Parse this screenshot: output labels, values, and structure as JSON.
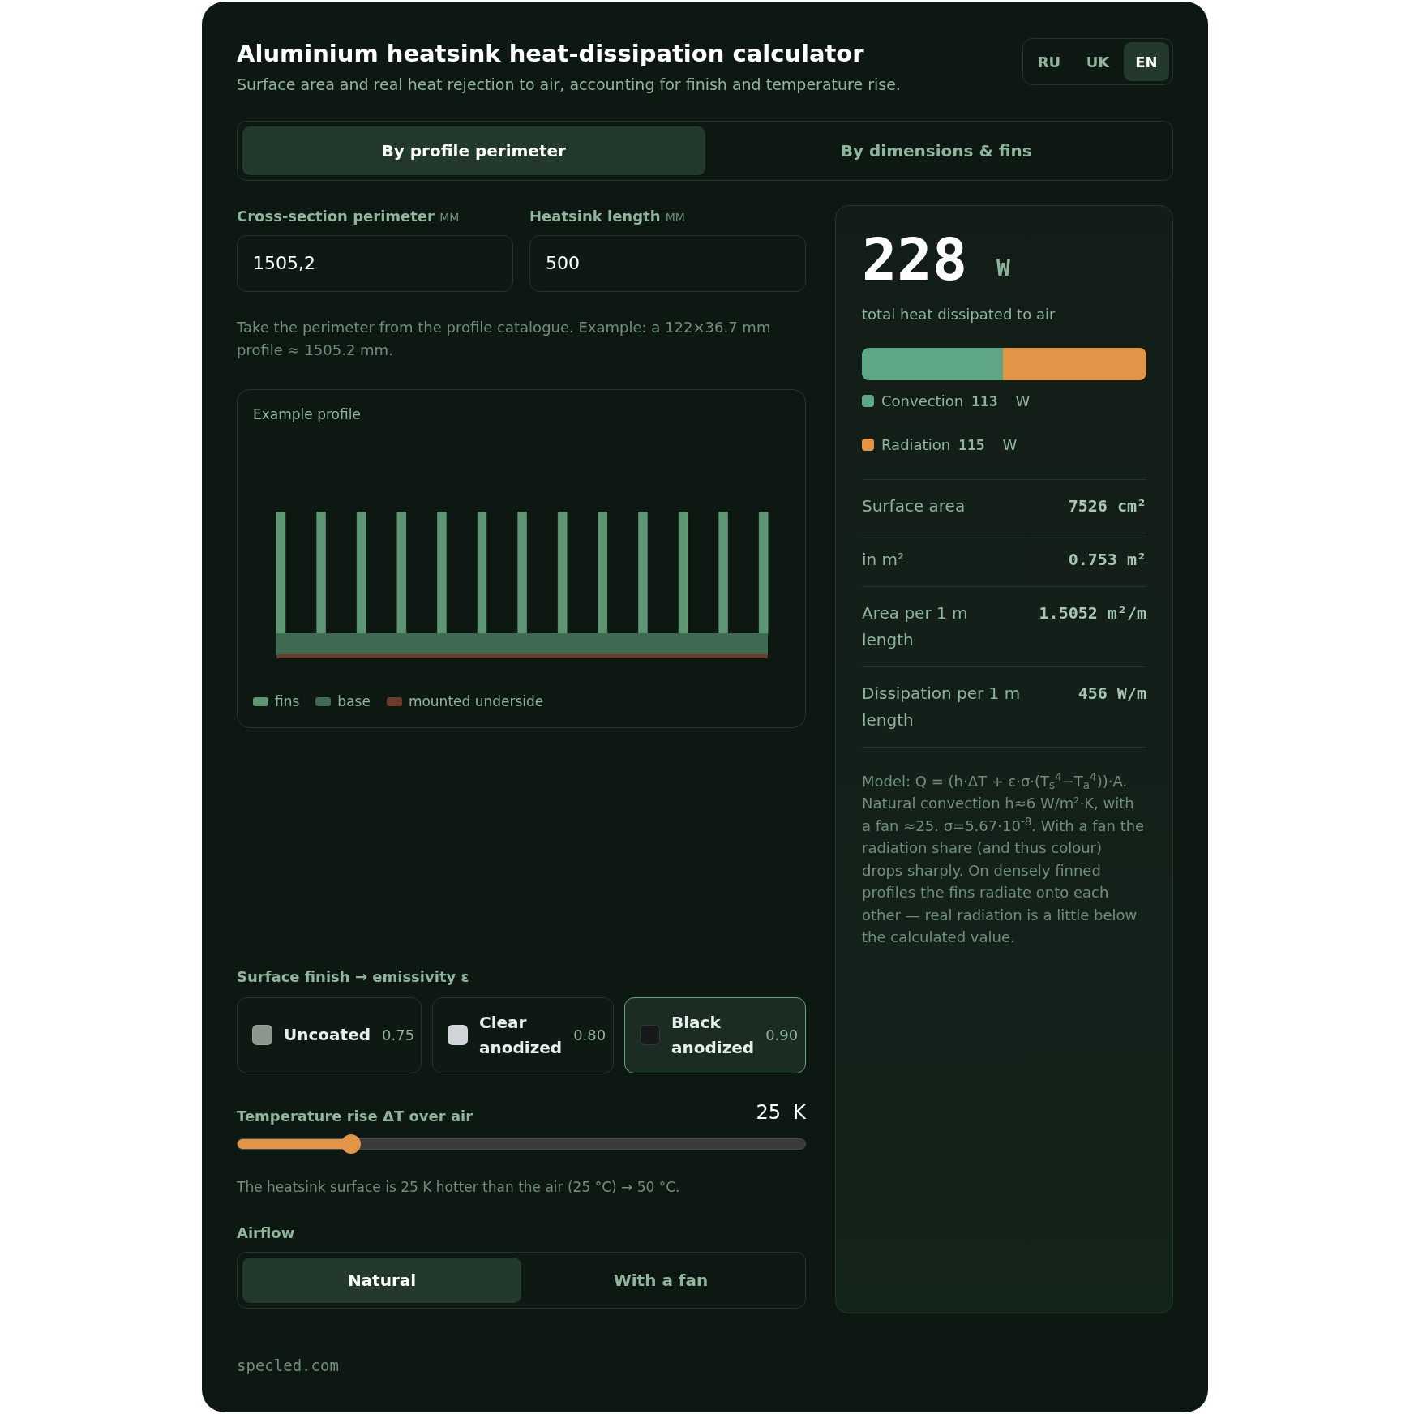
{
  "header": {
    "title": "Aluminium heatsink heat-dissipation calculator",
    "subtitle": "Surface area and real heat rejection to air, accounting for finish and temperature rise."
  },
  "languages": [
    {
      "label": "RU",
      "selected": false
    },
    {
      "label": "UK",
      "selected": false
    },
    {
      "label": "EN",
      "selected": true
    }
  ],
  "mode_tabs": [
    {
      "label": "By profile perimeter",
      "selected": true
    },
    {
      "label": "By dimensions & fins",
      "selected": false
    }
  ],
  "inputs": [
    {
      "label": "Cross-section perimeter",
      "unit": "MM",
      "value": "1505,2"
    },
    {
      "label": "Heatsink length",
      "unit": "MM",
      "value": "500"
    }
  ],
  "input_hint": "Take the perimeter from the profile catalogue. Example: a 122×36.7 mm profile ≈ 1505.2 mm.",
  "profile": {
    "title": "Example profile",
    "legend": [
      {
        "label": "fins",
        "color": "#5e9673"
      },
      {
        "label": "base",
        "color": "#3f6b52"
      },
      {
        "label": "mounted underside",
        "color": "#6b3b2c"
      }
    ]
  },
  "finish": {
    "label": "Surface finish → emissivity ε",
    "options": [
      {
        "label": "Uncoated",
        "value": "0.75",
        "color": "#8b968e",
        "selected": false
      },
      {
        "label": "Clear anodized",
        "value": "0.80",
        "color": "#d0d3d8",
        "selected": false
      },
      {
        "label": "Black anodized",
        "value": "0.90",
        "color": "#17191a",
        "selected": true
      }
    ]
  },
  "temperature": {
    "label": "Temperature rise ΔT over air",
    "value": "25",
    "unit": "K",
    "level": 0.2,
    "note": "The heatsink surface is 25 K hotter than the air (25 °C) → 50 °C."
  },
  "airflow": {
    "label": "Airflow",
    "options": [
      {
        "label": "Natural",
        "selected": true
      },
      {
        "label": "With a fan",
        "selected": false
      }
    ]
  },
  "footer": "specled.com",
  "result": {
    "value": "228",
    "unit": "W",
    "caption": "total heat dissipated to air",
    "parts": [
      {
        "label": "Convection",
        "value": "113",
        "unit": "W",
        "color": "#5fa784",
        "level": 0.495
      },
      {
        "label": "Radiation",
        "value": "115",
        "unit": "W",
        "color": "#e39547",
        "level": 0.505
      }
    ],
    "stats": [
      {
        "label": "Surface area",
        "value": "7526 cm²"
      },
      {
        "label": "in m²",
        "value": "0.753 m²"
      },
      {
        "label": "Area per 1 m length",
        "value": "1.5052 m²/m"
      },
      {
        "label": "Dissipation per 1 m length",
        "value": "456 W/m"
      }
    ],
    "note": "Model: Q = (h·ΔT + ε·σ·(T$_{s}$$^{4}$−T$_{a}$$^{4}$))·A. Natural convection h≈6 W/m²·K, with a fan ≈25. σ=5.67·10$^{-8}$. With a fan the radiation share (and thus colour) drops sharply. On densely finned profiles the fins radiate onto each other — real radiation is a little below the calculated value."
  }
}
